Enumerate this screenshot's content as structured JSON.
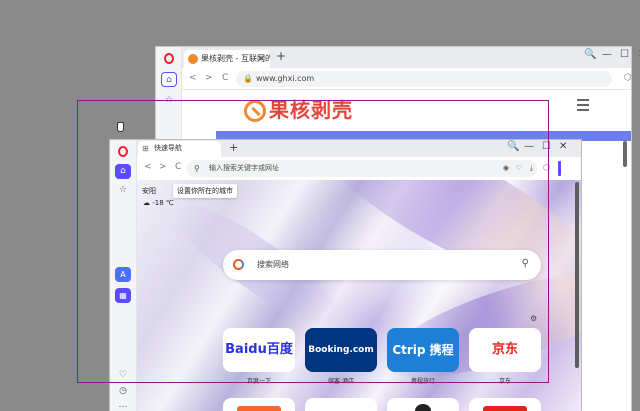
{
  "back_window": {
    "tab_title": "果核剥壳 - 互联网的守护士",
    "tab_close": "×",
    "new_tab": "+",
    "url": "www.ghxi.com",
    "site_logo": "果核剥壳",
    "window_controls": [
      "🔍",
      "—",
      "☐",
      "✕"
    ],
    "nav": {
      "back": "<",
      "forward": ">",
      "reload": "C"
    }
  },
  "front_window": {
    "tab_title": "快速导航",
    "new_tab": "+",
    "window_controls": [
      "🔍",
      "—",
      "☐",
      "✕"
    ],
    "address_placeholder": "输入搜索关键字或网址",
    "nav": {
      "back": "<",
      "forward": ">",
      "reload": "C"
    },
    "city": "安阳",
    "city_tooltip": "设置你所在的城市",
    "temperature": "-18 ℃",
    "search_placeholder": "搜索网络",
    "speed_dial": [
      {
        "name": "Baidu百度",
        "label": "百度一下",
        "color": "#2932e1",
        "bg": "#ffffff"
      },
      {
        "name": "Booking.com",
        "label": "缤客·酒店",
        "color": "#ffffff",
        "bg": "#003580"
      },
      {
        "name": "Ctrip 携程",
        "label": "携程旅行",
        "color": "#ffffff",
        "bg": "#1e7fd6"
      },
      {
        "name": "京东",
        "label": "京东",
        "color": "#e1251b",
        "bg": "#ffffff"
      }
    ]
  },
  "colors": {
    "accent": "#5b4bff",
    "selection": "#8b1a8b",
    "opera_red": "#ff1b2d"
  }
}
